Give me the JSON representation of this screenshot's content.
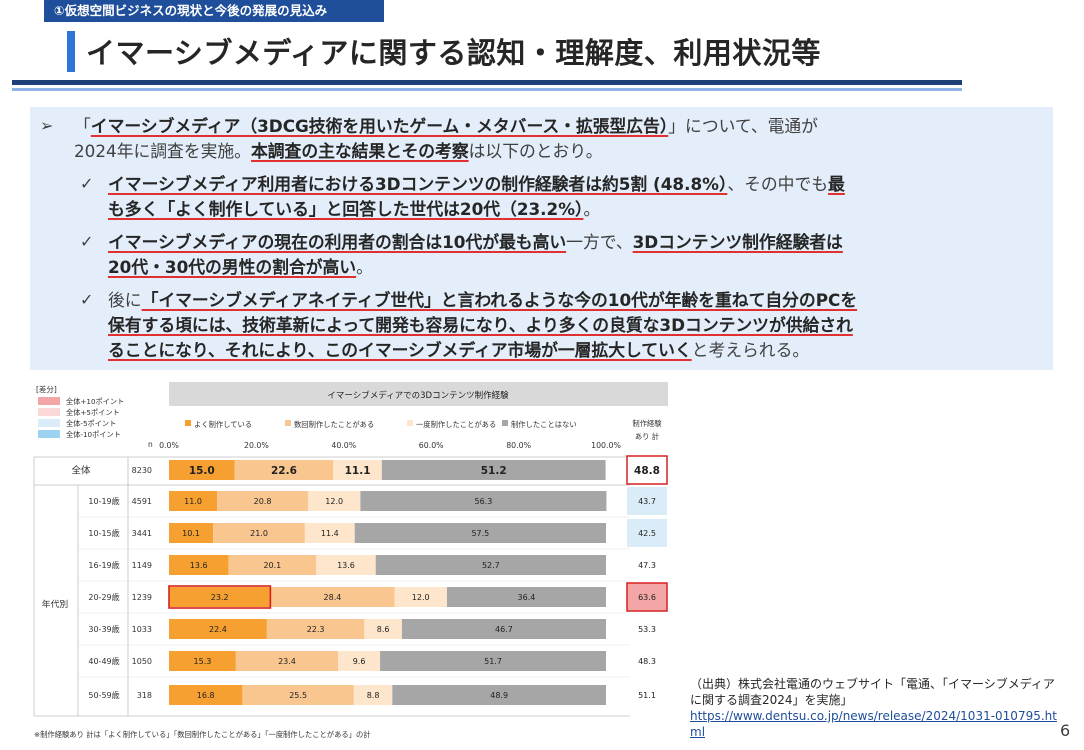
{
  "header": {
    "section_tag": "①仮想空間ビジネスの現状と今後の発展の見込み",
    "title": "イマーシブメディアに関する認知・理解度、利用状況等"
  },
  "summary": {
    "intro": {
      "open_quote": "「",
      "topic": "イマーシブメディア（3DCG技術を用いたゲーム・メタバース・拡張型広告）",
      "close_mid": "」について、電通が",
      "line2_plain": "2024年に調査を実施。",
      "line2_bold": "本調査の主な結果とその考察",
      "line2_end": "は以下のとおり。"
    },
    "point1": {
      "l1_bold": "イマーシブメディア利用者における3Dコンテンツの制作経験者は約5割 (48.8%）",
      "l1_plain": "、その中でも",
      "l1_tail": "最",
      "l2_bold": "も多く「よく制作している」と回答した世代は20代（23.2%）",
      "l2_end": "。"
    },
    "point2": {
      "l1_bold": "イマーシブメディアの現在の利用者の割合は10代が最も高い",
      "l1_plain": "一方で、",
      "l1_tail": "3Dコンテンツ制作経験者は",
      "l2_bold": "20代・30代の男性の割合が高い",
      "l2_end": "。"
    },
    "point3": {
      "l1_plain": "後に",
      "l1_bold": "「イマーシブメディアネイティブ世代」と言われるような今の10代が年齢を重ねて自分のPCを",
      "l2_bold": "保有する頃には、技術革新によって開発も容易になり、より多くの良質な3Dコンテンツが供給され",
      "l3_bold": "ることになり、それにより、このイマーシブメディア市場が一層拡大していく",
      "l3_end": "と考えられる。"
    },
    "markers": {
      "arrow": "➢",
      "check": "✓"
    }
  },
  "chart_data": {
    "type": "bar",
    "stacked": true,
    "orientation": "horizontal",
    "title": "イマーシブメディアでの3Dコンテンツ制作経験",
    "diff_legend": {
      "title": "[差分]",
      "items": [
        "全体+10ポイント",
        "全体+5ポイント",
        "全体-5ポイント",
        "全体-10ポイント"
      ],
      "colors": [
        "#f4a6a6",
        "#fbd9d9",
        "#d9ecf8",
        "#9dd3f0"
      ]
    },
    "xlim": [
      0,
      100
    ],
    "ticks": [
      "0.0%",
      "20.0%",
      "40.0%",
      "60.0%",
      "80.0%",
      "100.0%"
    ],
    "n_label": "n",
    "right_header": [
      "制作経験",
      "あり 計"
    ],
    "group_label": "年代別",
    "series": [
      {
        "name": "よく制作している",
        "color": "#f5a030"
      },
      {
        "name": "数回制作したことがある",
        "color": "#fac690"
      },
      {
        "name": "一度制作したことがある",
        "color": "#fde6cc"
      },
      {
        "name": "制作したことはない",
        "color": "#a6a6a6"
      }
    ],
    "rows": [
      {
        "label": "全体",
        "n": "8230",
        "values": [
          15.0,
          22.6,
          11.1,
          51.2
        ],
        "total": "48.8",
        "total_style": "box"
      },
      {
        "label": "10-19歳",
        "n": "4591",
        "values": [
          11.0,
          20.8,
          12.0,
          56.3
        ],
        "total": "43.7",
        "total_style": "minus5"
      },
      {
        "label": "10-15歳",
        "n": "3441",
        "values": [
          10.1,
          21.0,
          11.4,
          57.5
        ],
        "total": "42.5",
        "total_style": "minus5"
      },
      {
        "label": "16-19歳",
        "n": "1149",
        "values": [
          13.6,
          20.1,
          13.6,
          52.7
        ],
        "total": "47.3",
        "total_style": "none"
      },
      {
        "label": "20-29歳",
        "n": "1239",
        "values": [
          23.2,
          28.4,
          12.0,
          36.4
        ],
        "total": "63.6",
        "total_style": "plus10"
      },
      {
        "label": "30-39歳",
        "n": "1033",
        "values": [
          22.4,
          22.3,
          8.6,
          46.7
        ],
        "total": "53.3",
        "total_style": "none"
      },
      {
        "label": "40-49歳",
        "n": "1050",
        "values": [
          15.3,
          23.4,
          9.6,
          51.7
        ],
        "total": "48.3",
        "total_style": "none"
      },
      {
        "label": "50-59歳",
        "n": "318",
        "values": [
          16.8,
          25.5,
          8.8,
          48.9
        ],
        "total": "51.1",
        "total_style": "none"
      }
    ],
    "highlight": {
      "row": 4,
      "segment": 0
    },
    "footnote": "※制作経験あり 計は「よく制作している」「数回制作したことがある」「一度制作したことがある」の計"
  },
  "source": {
    "text": "（出典）株式会社電通のウェブサイト「電通、「イマーシブメディアに関する調査2024」を実施」",
    "url": "https://www.dentsu.co.jp/news/release/2024/1031-010795.html"
  },
  "page_number": "6"
}
